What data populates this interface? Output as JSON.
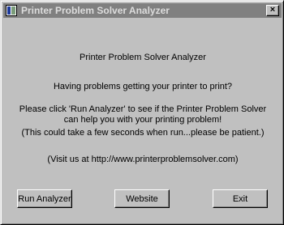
{
  "window": {
    "title": "Printer Problem Solver Analyzer",
    "close_glyph": "×"
  },
  "content": {
    "heading": "Printer Problem Solver Analyzer",
    "question": "Having problems getting your printer to print?",
    "instruction_line1": "Please click 'Run Analyzer' to see if the Printer Problem Solver",
    "instruction_line2": "can help you with your printing problem!",
    "note": "(This could take a few seconds when run...please be patient.)",
    "visit": "(Visit us at http://www.printerproblemsolver.com)"
  },
  "buttons": {
    "run_analyzer": "Run Analyzer",
    "website": "Website",
    "exit": "Exit"
  },
  "colors": {
    "face": "#c0c0c0",
    "titlebar_inactive": "#808080",
    "title_text": "#dcdcdc"
  }
}
